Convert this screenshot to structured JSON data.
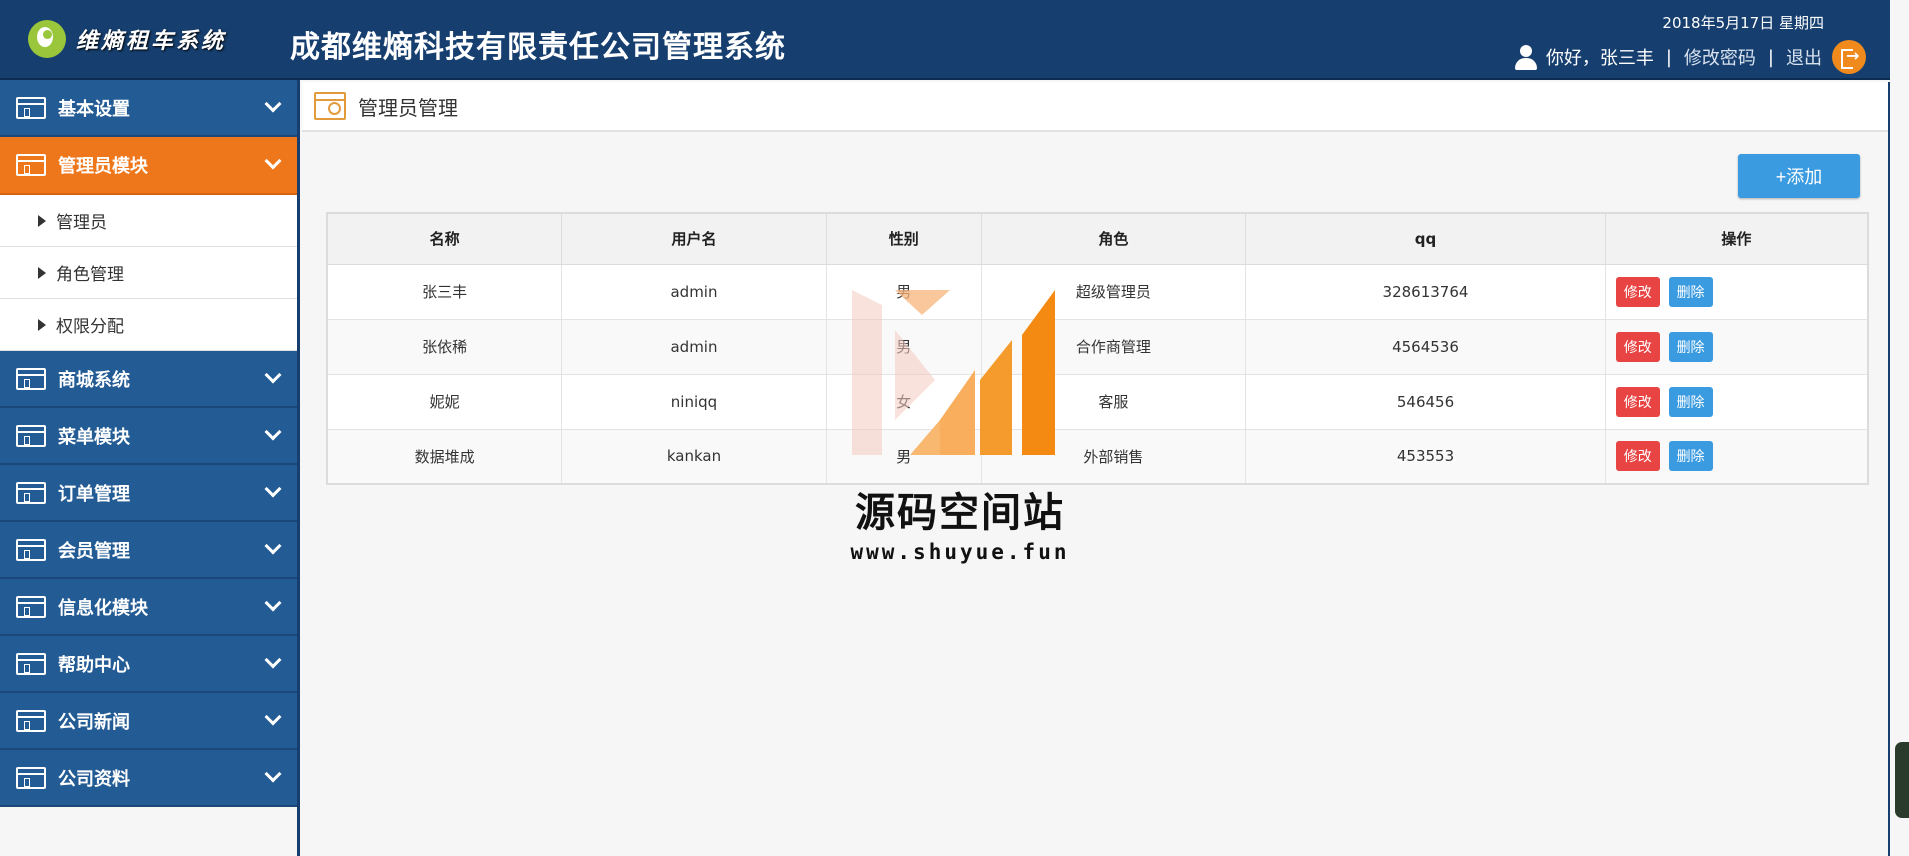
{
  "header": {
    "logo_text": "维熵租车系统",
    "system_title": "成都维熵科技有限责任公司管理系统",
    "date": "2018年5月17日 星期四",
    "greeting": "你好，张三丰",
    "change_password": "修改密码",
    "logout": "退出",
    "separator": "|"
  },
  "sidebar": {
    "menus": [
      {
        "label": "基本设置",
        "active": false
      },
      {
        "label": "管理员模块",
        "active": true
      },
      {
        "label": "商城系统",
        "active": false
      },
      {
        "label": "菜单模块",
        "active": false
      },
      {
        "label": "订单管理",
        "active": false
      },
      {
        "label": "会员管理",
        "active": false
      },
      {
        "label": "信息化模块",
        "active": false
      },
      {
        "label": "帮助中心",
        "active": false
      },
      {
        "label": "公司新闻",
        "active": false
      },
      {
        "label": "公司资料",
        "active": false
      }
    ],
    "submenu": [
      "管理员",
      "角色管理",
      "权限分配"
    ]
  },
  "page": {
    "title": "管理员管理",
    "add_button": "+添加"
  },
  "table": {
    "columns": [
      "名称",
      "用户名",
      "性别",
      "角色",
      "qq",
      "操作"
    ],
    "rows": [
      {
        "name": "张三丰",
        "username": "admin",
        "gender": "男",
        "role": "超级管理员",
        "qq": "328613764"
      },
      {
        "name": "张依稀",
        "username": "admin",
        "gender": "男",
        "role": "合作商管理",
        "qq": "4564536"
      },
      {
        "name": "妮妮",
        "username": "niniqq",
        "gender": "女",
        "role": "客服",
        "qq": "546456"
      },
      {
        "name": "数据堆成",
        "username": "kankan",
        "gender": "男",
        "role": "外部销售",
        "qq": "453553"
      }
    ],
    "edit_label": "修改",
    "delete_label": "删除"
  },
  "watermark": {
    "text": "源码空间站",
    "url": "www.shuyue.fun"
  },
  "colors": {
    "header_bg": "#163f6f",
    "menu_bg": "#235b94",
    "menu_active": "#ee771c",
    "btn_blue": "#3a9be0",
    "btn_red": "#e84444"
  }
}
